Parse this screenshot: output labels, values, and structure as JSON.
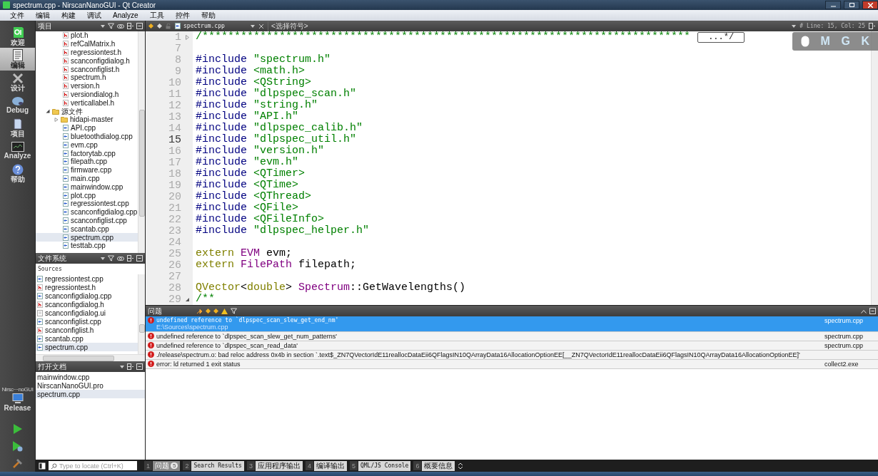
{
  "window": {
    "title": "spectrum.cpp - NirscanNanoGUI - Qt Creator"
  },
  "menu": [
    "文件",
    "编辑",
    "构建",
    "调试",
    "Analyze",
    "工具",
    "控件",
    "帮助"
  ],
  "modes": [
    {
      "kind": "welcome",
      "label": "欢迎",
      "selected": false
    },
    {
      "kind": "edit",
      "label": "编辑",
      "selected": true
    },
    {
      "kind": "design",
      "label": "设计",
      "selected": false
    },
    {
      "kind": "debug",
      "label": "Debug",
      "selected": false
    },
    {
      "kind": "projects",
      "label": "项目",
      "selected": false
    },
    {
      "kind": "analyze",
      "label": "Analyze",
      "selected": false
    },
    {
      "kind": "help",
      "label": "帮助",
      "selected": false
    }
  ],
  "target": {
    "project": "Nirsc···noGUI",
    "config": "Release"
  },
  "project_panel": {
    "title": "项目",
    "tree": [
      {
        "kind": "cut-parent",
        "children": [
          {
            "kind": "h",
            "label": "plot.h",
            "selected": false
          },
          {
            "kind": "h",
            "label": "refCalMatrix.h",
            "selected": false
          },
          {
            "kind": "h",
            "label": "regressiontest.h",
            "selected": false
          },
          {
            "kind": "h",
            "label": "scanconfigdialog.h",
            "selected": false
          },
          {
            "kind": "h",
            "label": "scanconfiglist.h",
            "selected": false
          },
          {
            "kind": "h",
            "label": "spectrum.h",
            "selected": false
          },
          {
            "kind": "h",
            "label": "version.h",
            "selected": false
          },
          {
            "kind": "h",
            "label": "versiondialog.h",
            "selected": false
          },
          {
            "kind": "h",
            "label": "verticallabel.h",
            "selected": false
          }
        ]
      },
      {
        "kind": "folder",
        "label": "源文件",
        "expanded": true,
        "selected": false,
        "children": [
          {
            "kind": "folder",
            "label": "hidapi-master",
            "expanded": false,
            "selected": false
          },
          {
            "kind": "cpp",
            "label": "API.cpp",
            "selected": false
          },
          {
            "kind": "cpp",
            "label": "bluetoothdialog.cpp",
            "selected": false
          },
          {
            "kind": "cpp",
            "label": "evm.cpp",
            "selected": false
          },
          {
            "kind": "cpp",
            "label": "factorytab.cpp",
            "selected": false
          },
          {
            "kind": "cpp",
            "label": "filepath.cpp",
            "selected": false
          },
          {
            "kind": "cpp",
            "label": "firmware.cpp",
            "selected": false
          },
          {
            "kind": "cpp",
            "label": "main.cpp",
            "selected": false
          },
          {
            "kind": "cpp",
            "label": "mainwindow.cpp",
            "selected": false
          },
          {
            "kind": "cpp",
            "label": "plot.cpp",
            "selected": false
          },
          {
            "kind": "cpp",
            "label": "regressiontest.cpp",
            "selected": false
          },
          {
            "kind": "cpp",
            "label": "scanconfigdialog.cpp",
            "selected": false
          },
          {
            "kind": "cpp",
            "label": "scanconfiglist.cpp",
            "selected": false
          },
          {
            "kind": "cpp",
            "label": "scantab.cpp",
            "selected": false
          },
          {
            "kind": "cpp",
            "label": "spectrum.cpp",
            "selected": true
          },
          {
            "kind": "cpp",
            "label": "testtab.cpp",
            "selected": false
          }
        ]
      }
    ]
  },
  "filesystem_panel": {
    "title": "文件系统",
    "folder": "Sources",
    "files": [
      {
        "kind": "cpp",
        "label": "regressiontest.cpp",
        "selected": false
      },
      {
        "kind": "h",
        "label": "regressiontest.h",
        "selected": false
      },
      {
        "kind": "cpp",
        "label": "scanconfigdialog.cpp",
        "selected": false
      },
      {
        "kind": "h",
        "label": "scanconfigdialog.h",
        "selected": false
      },
      {
        "kind": "ui",
        "label": "scanconfigdialog.ui",
        "selected": false
      },
      {
        "kind": "cpp",
        "label": "scanconfiglist.cpp",
        "selected": false
      },
      {
        "kind": "h",
        "label": "scanconfiglist.h",
        "selected": false
      },
      {
        "kind": "cpp",
        "label": "scantab.cpp",
        "selected": false
      },
      {
        "kind": "cpp",
        "label": "spectrum.cpp",
        "selected": true
      }
    ]
  },
  "open_documents": {
    "title": "打开文档",
    "documents": [
      {
        "label": "mainwindow.cpp",
        "selected": false
      },
      {
        "label": "NirscanNanoGUI.pro",
        "selected": false
      },
      {
        "label": "spectrum.cpp",
        "selected": true
      }
    ]
  },
  "editor": {
    "file": "spectrum.cpp",
    "symbol": "<选择符号>",
    "hash": "#",
    "position": "Line: 15, Col: 25",
    "fold_placeholder": "...*/",
    "lines": [
      {
        "number": "1",
        "current": false,
        "collapsed": true,
        "tokens": [
          {
            "kind": "comment",
            "text": "/****************************************************************************"
          }
        ]
      },
      {
        "number": "7",
        "current": false
      },
      {
        "number": "8",
        "current": false,
        "tokens": [
          {
            "kind": "directive",
            "text": "#include"
          },
          {
            "kind": "string",
            "text": " \"spectrum.h\""
          }
        ]
      },
      {
        "number": "9",
        "current": false,
        "tokens": [
          {
            "kind": "directive",
            "text": "#include"
          },
          {
            "kind": "string",
            "text": " <math.h>"
          }
        ]
      },
      {
        "number": "10",
        "current": false,
        "tokens": [
          {
            "kind": "directive",
            "text": "#include"
          },
          {
            "kind": "string",
            "text": " <QString>"
          }
        ]
      },
      {
        "number": "11",
        "current": false,
        "tokens": [
          {
            "kind": "directive",
            "text": "#include"
          },
          {
            "kind": "string",
            "text": " \"dlpspec_scan.h\""
          }
        ]
      },
      {
        "number": "12",
        "current": false,
        "tokens": [
          {
            "kind": "directive",
            "text": "#include"
          },
          {
            "kind": "string",
            "text": " \"string.h\""
          }
        ]
      },
      {
        "number": "13",
        "current": false,
        "tokens": [
          {
            "kind": "directive",
            "text": "#include"
          },
          {
            "kind": "string",
            "text": " \"API.h\""
          }
        ]
      },
      {
        "number": "14",
        "current": false,
        "tokens": [
          {
            "kind": "directive",
            "text": "#include"
          },
          {
            "kind": "string",
            "text": " \"dlpspec_calib.h\""
          }
        ]
      },
      {
        "number": "15",
        "current": true,
        "tokens": [
          {
            "kind": "directive",
            "text": "#include"
          },
          {
            "kind": "string",
            "text": " \"dlpspec_util.h\""
          }
        ]
      },
      {
        "number": "16",
        "current": false,
        "tokens": [
          {
            "kind": "directive",
            "text": "#include"
          },
          {
            "kind": "string",
            "text": " \"version.h\""
          }
        ]
      },
      {
        "number": "17",
        "current": false,
        "tokens": [
          {
            "kind": "directive",
            "text": "#include"
          },
          {
            "kind": "string",
            "text": " \"evm.h\""
          }
        ]
      },
      {
        "number": "18",
        "current": false,
        "tokens": [
          {
            "kind": "directive",
            "text": "#include"
          },
          {
            "kind": "string",
            "text": " <QTimer>"
          }
        ]
      },
      {
        "number": "19",
        "current": false,
        "tokens": [
          {
            "kind": "directive",
            "text": "#include"
          },
          {
            "kind": "string",
            "text": " <QTime>"
          }
        ]
      },
      {
        "number": "20",
        "current": false,
        "tokens": [
          {
            "kind": "directive",
            "text": "#include"
          },
          {
            "kind": "string",
            "text": " <QThread>"
          }
        ]
      },
      {
        "number": "21",
        "current": false,
        "tokens": [
          {
            "kind": "directive",
            "text": "#include"
          },
          {
            "kind": "string",
            "text": " <QFile>"
          }
        ]
      },
      {
        "number": "22",
        "current": false,
        "tokens": [
          {
            "kind": "directive",
            "text": "#include"
          },
          {
            "kind": "string",
            "text": " <QFileInfo>"
          }
        ]
      },
      {
        "number": "23",
        "current": false,
        "tokens": [
          {
            "kind": "directive",
            "text": "#include"
          },
          {
            "kind": "string",
            "text": " \"dlpspec_helper.h\""
          }
        ]
      },
      {
        "number": "24",
        "current": false
      },
      {
        "number": "25",
        "current": false,
        "tokens": [
          {
            "kind": "keyword",
            "text": "extern"
          },
          {
            "kind": "type",
            "text": " EVM"
          },
          {
            "kind": "plain",
            "text": " evm;"
          }
        ]
      },
      {
        "number": "26",
        "current": false,
        "tokens": [
          {
            "kind": "keyword",
            "text": "extern"
          },
          {
            "kind": "type",
            "text": " FilePath"
          },
          {
            "kind": "plain",
            "text": " filepath;"
          }
        ]
      },
      {
        "number": "27",
        "current": false
      },
      {
        "number": "28",
        "current": false,
        "tokens": [
          {
            "kind": "keyword",
            "text": "QVector"
          },
          {
            "kind": "plain",
            "text": "<"
          },
          {
            "kind": "keyword",
            "text": "double"
          },
          {
            "kind": "plain",
            "text": "> "
          },
          {
            "kind": "type",
            "text": "Spectrum"
          },
          {
            "kind": "plain",
            "text": "::GetWavelengths()"
          }
        ]
      },
      {
        "number": "29",
        "current": false,
        "collapsed": false,
        "tokens": [
          {
            "kind": "comment",
            "text": "/**"
          }
        ]
      }
    ]
  },
  "key_overlay": {
    "keys": [
      "M",
      "G",
      "K"
    ]
  },
  "issues": {
    "title": "问题",
    "rows": [
      {
        "message": "undefined reference to `dlpspec_scan_slew_get_end_nm'",
        "path": "E:\\Sources\\spectrum.cpp",
        "file": "spectrum.cpp",
        "selected": true
      },
      {
        "message": "undefined reference to `dlpspec_scan_slew_get_num_patterns'",
        "file": "spectrum.cpp",
        "selected": false
      },
      {
        "message": "undefined reference to `dlpspec_scan_read_data'",
        "file": "spectrum.cpp",
        "selected": false
      },
      {
        "message": "./release\\spectrum.o: bad reloc address 0x4b in section `.text$_ZN7QVectorIdE11reallocDataEii6QFlagsIN10QArrayData16AllocationOptionEE[__ZN7QVectorIdE11reallocDataEii6QFlagsIN10QArrayData16AllocationOptionEE]'",
        "selected": false
      },
      {
        "message": "error: ld returned 1 exit status",
        "file": "collect2.exe",
        "selected": false
      }
    ]
  },
  "bottom_bar": {
    "locate_placeholder": "Type to locate (Ctrl+K)",
    "panes": [
      {
        "number": "1",
        "label": "问题",
        "badge": "5",
        "selected": true
      },
      {
        "number": "2",
        "label": "Search Results",
        "selected": false
      },
      {
        "number": "3",
        "label": "应用程序输出",
        "selected": false
      },
      {
        "number": "4",
        "label": "编译输出",
        "selected": false
      },
      {
        "number": "5",
        "label": "QML/JS Console",
        "selected": false
      },
      {
        "number": "6",
        "label": "概要信息",
        "selected": false
      }
    ]
  }
}
